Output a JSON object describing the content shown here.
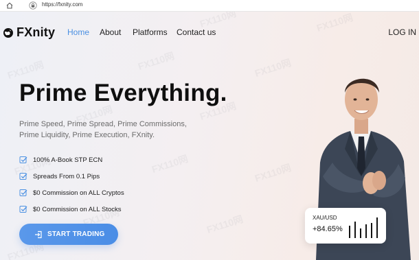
{
  "browser": {
    "url": "https://fxnity.com"
  },
  "header": {
    "logo_text": "FXnity",
    "nav": [
      {
        "label": "Home",
        "active": true
      },
      {
        "label": "About",
        "active": false
      },
      {
        "label": "Platforms",
        "active": false
      },
      {
        "label": "Contact us",
        "active": false
      }
    ],
    "login_label": "LOG IN"
  },
  "hero": {
    "title": "Prime Everything.",
    "subtitle": "Prime Speed, Prime Spread, Prime Commissions, Prime Liquidity, Prime Execution, FXnity.",
    "features": [
      "100% A-Book STP ECN",
      "Spreads From 0.1 Pips",
      "$0 Commission on ALL Cryptos",
      "$0 Commission on ALL Stocks"
    ],
    "cta_label": "START TRADING"
  },
  "ticker": {
    "symbol": "XAU/USD",
    "change": "+84.65%"
  },
  "watermark_text": "FX110网",
  "colors": {
    "accent": "#4a90e2",
    "cta": "#5096e8",
    "check": "#4a90e2",
    "title": "#0f0f0f"
  },
  "icons": {
    "browser_home": "home-icon",
    "browser_lock": "lock-icon",
    "logo": "globe-icon",
    "feature": "checkbox-icon",
    "cta": "login-arrow-icon"
  }
}
